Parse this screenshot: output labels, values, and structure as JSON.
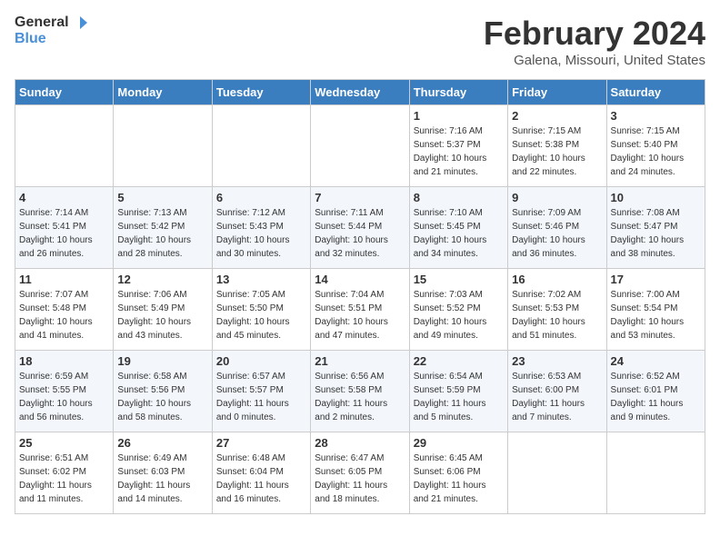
{
  "logo": {
    "general": "General",
    "blue": "Blue"
  },
  "header": {
    "month": "February 2024",
    "location": "Galena, Missouri, United States"
  },
  "days_of_week": [
    "Sunday",
    "Monday",
    "Tuesday",
    "Wednesday",
    "Thursday",
    "Friday",
    "Saturday"
  ],
  "weeks": [
    [
      {
        "day": "",
        "info": ""
      },
      {
        "day": "",
        "info": ""
      },
      {
        "day": "",
        "info": ""
      },
      {
        "day": "",
        "info": ""
      },
      {
        "day": "1",
        "info": "Sunrise: 7:16 AM\nSunset: 5:37 PM\nDaylight: 10 hours\nand 21 minutes."
      },
      {
        "day": "2",
        "info": "Sunrise: 7:15 AM\nSunset: 5:38 PM\nDaylight: 10 hours\nand 22 minutes."
      },
      {
        "day": "3",
        "info": "Sunrise: 7:15 AM\nSunset: 5:40 PM\nDaylight: 10 hours\nand 24 minutes."
      }
    ],
    [
      {
        "day": "4",
        "info": "Sunrise: 7:14 AM\nSunset: 5:41 PM\nDaylight: 10 hours\nand 26 minutes."
      },
      {
        "day": "5",
        "info": "Sunrise: 7:13 AM\nSunset: 5:42 PM\nDaylight: 10 hours\nand 28 minutes."
      },
      {
        "day": "6",
        "info": "Sunrise: 7:12 AM\nSunset: 5:43 PM\nDaylight: 10 hours\nand 30 minutes."
      },
      {
        "day": "7",
        "info": "Sunrise: 7:11 AM\nSunset: 5:44 PM\nDaylight: 10 hours\nand 32 minutes."
      },
      {
        "day": "8",
        "info": "Sunrise: 7:10 AM\nSunset: 5:45 PM\nDaylight: 10 hours\nand 34 minutes."
      },
      {
        "day": "9",
        "info": "Sunrise: 7:09 AM\nSunset: 5:46 PM\nDaylight: 10 hours\nand 36 minutes."
      },
      {
        "day": "10",
        "info": "Sunrise: 7:08 AM\nSunset: 5:47 PM\nDaylight: 10 hours\nand 38 minutes."
      }
    ],
    [
      {
        "day": "11",
        "info": "Sunrise: 7:07 AM\nSunset: 5:48 PM\nDaylight: 10 hours\nand 41 minutes."
      },
      {
        "day": "12",
        "info": "Sunrise: 7:06 AM\nSunset: 5:49 PM\nDaylight: 10 hours\nand 43 minutes."
      },
      {
        "day": "13",
        "info": "Sunrise: 7:05 AM\nSunset: 5:50 PM\nDaylight: 10 hours\nand 45 minutes."
      },
      {
        "day": "14",
        "info": "Sunrise: 7:04 AM\nSunset: 5:51 PM\nDaylight: 10 hours\nand 47 minutes."
      },
      {
        "day": "15",
        "info": "Sunrise: 7:03 AM\nSunset: 5:52 PM\nDaylight: 10 hours\nand 49 minutes."
      },
      {
        "day": "16",
        "info": "Sunrise: 7:02 AM\nSunset: 5:53 PM\nDaylight: 10 hours\nand 51 minutes."
      },
      {
        "day": "17",
        "info": "Sunrise: 7:00 AM\nSunset: 5:54 PM\nDaylight: 10 hours\nand 53 minutes."
      }
    ],
    [
      {
        "day": "18",
        "info": "Sunrise: 6:59 AM\nSunset: 5:55 PM\nDaylight: 10 hours\nand 56 minutes."
      },
      {
        "day": "19",
        "info": "Sunrise: 6:58 AM\nSunset: 5:56 PM\nDaylight: 10 hours\nand 58 minutes."
      },
      {
        "day": "20",
        "info": "Sunrise: 6:57 AM\nSunset: 5:57 PM\nDaylight: 11 hours\nand 0 minutes."
      },
      {
        "day": "21",
        "info": "Sunrise: 6:56 AM\nSunset: 5:58 PM\nDaylight: 11 hours\nand 2 minutes."
      },
      {
        "day": "22",
        "info": "Sunrise: 6:54 AM\nSunset: 5:59 PM\nDaylight: 11 hours\nand 5 minutes."
      },
      {
        "day": "23",
        "info": "Sunrise: 6:53 AM\nSunset: 6:00 PM\nDaylight: 11 hours\nand 7 minutes."
      },
      {
        "day": "24",
        "info": "Sunrise: 6:52 AM\nSunset: 6:01 PM\nDaylight: 11 hours\nand 9 minutes."
      }
    ],
    [
      {
        "day": "25",
        "info": "Sunrise: 6:51 AM\nSunset: 6:02 PM\nDaylight: 11 hours\nand 11 minutes."
      },
      {
        "day": "26",
        "info": "Sunrise: 6:49 AM\nSunset: 6:03 PM\nDaylight: 11 hours\nand 14 minutes."
      },
      {
        "day": "27",
        "info": "Sunrise: 6:48 AM\nSunset: 6:04 PM\nDaylight: 11 hours\nand 16 minutes."
      },
      {
        "day": "28",
        "info": "Sunrise: 6:47 AM\nSunset: 6:05 PM\nDaylight: 11 hours\nand 18 minutes."
      },
      {
        "day": "29",
        "info": "Sunrise: 6:45 AM\nSunset: 6:06 PM\nDaylight: 11 hours\nand 21 minutes."
      },
      {
        "day": "",
        "info": ""
      },
      {
        "day": "",
        "info": ""
      }
    ]
  ]
}
